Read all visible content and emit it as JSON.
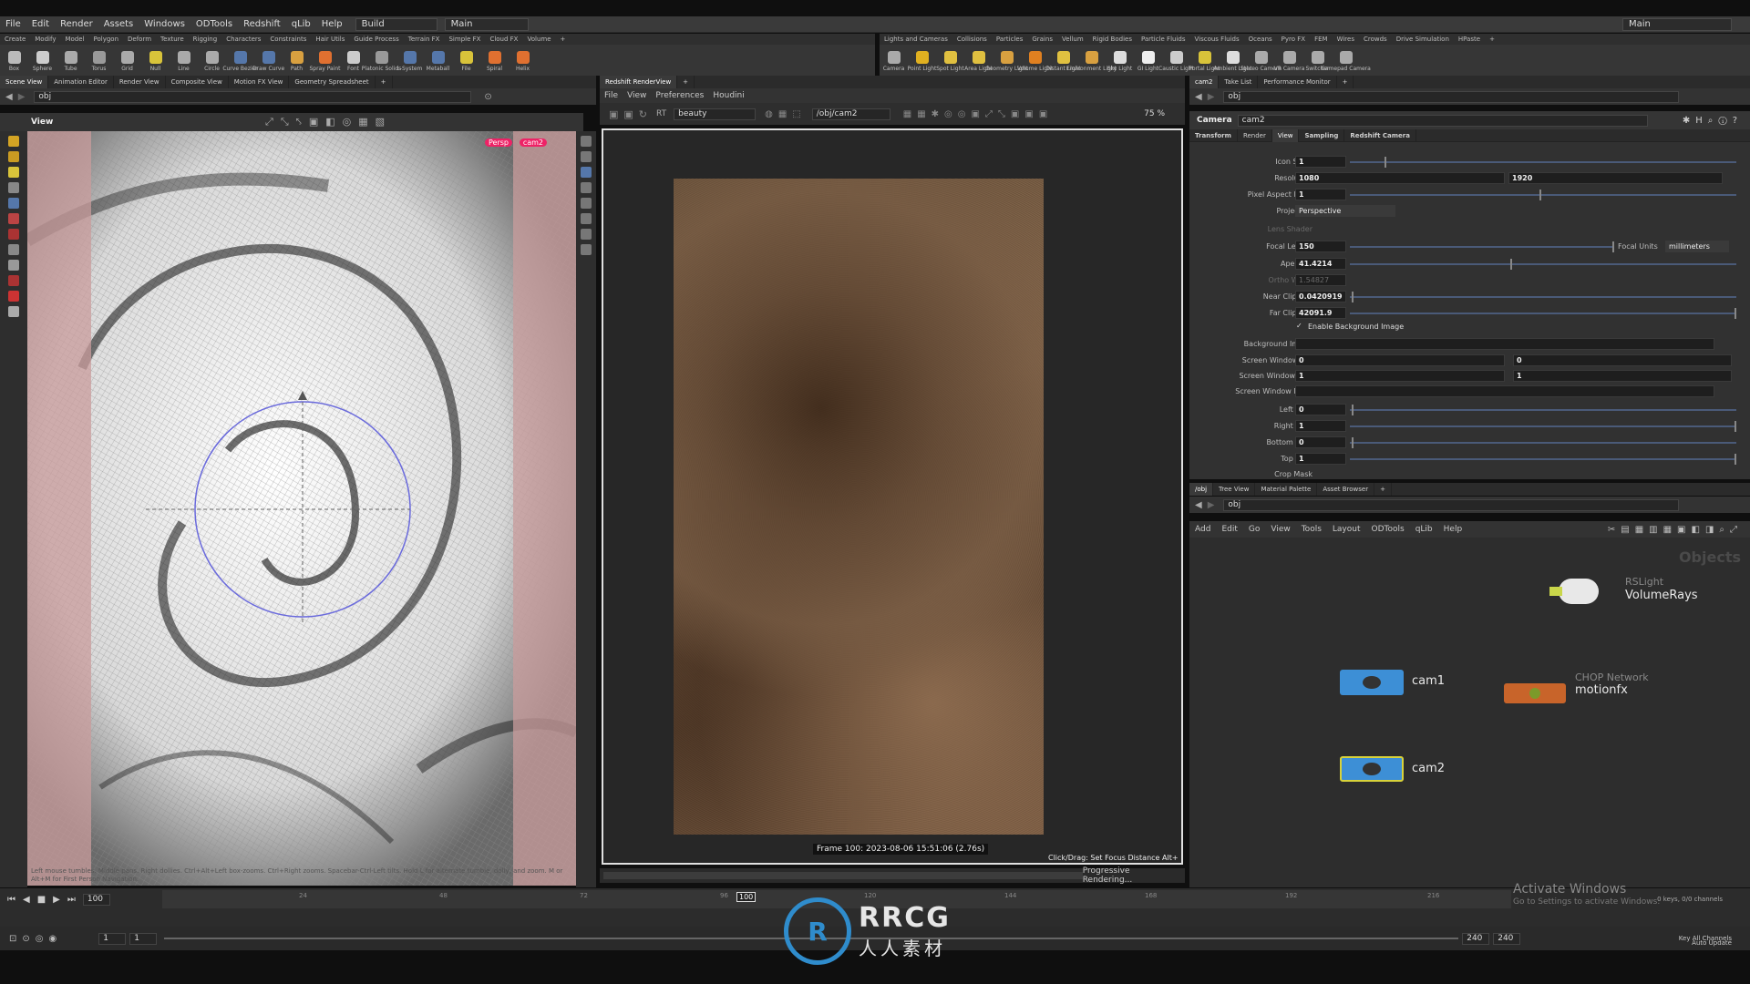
{
  "menu": {
    "items": [
      "File",
      "Edit",
      "Render",
      "Assets",
      "Windows",
      "ODTools",
      "Redshift",
      "qLib",
      "Help"
    ],
    "desktop_label": "Build",
    "context_label": "Main",
    "right_label": "Main"
  },
  "shelf": {
    "tabs_left": [
      "Create",
      "Modify",
      "Model",
      "Polygon",
      "Deform",
      "Texture",
      "Rigging",
      "Characters",
      "Constraints",
      "Hair Utils",
      "Guide Process",
      "Terrain FX",
      "Simple FX",
      "Cloud FX",
      "Volume"
    ],
    "tabs_right": [
      "Lights and Cameras",
      "Collisions",
      "Particles",
      "Grains",
      "Vellum",
      "Rigid Bodies",
      "Particle Fluids",
      "Viscous Fluids",
      "Oceans",
      "Pyro FX",
      "FEM",
      "Wires",
      "Crowds",
      "Drive Simulation",
      "HPaste"
    ],
    "tools_left": [
      "Box",
      "Sphere",
      "Tube",
      "Torus",
      "Grid",
      "Null",
      "Line",
      "Circle",
      "Curve Bezier",
      "Draw Curve",
      "Path",
      "Spray Paint",
      "Font",
      "Platonic Solids",
      "L-System",
      "Metaball",
      "File",
      "Spiral",
      "Helix"
    ],
    "tools_right": [
      "Camera",
      "Point Light",
      "Spot Light",
      "Area Light",
      "Geometry Light",
      "Volume Light",
      "Distant Light",
      "Environment Light",
      "Sky Light",
      "GI Light",
      "Caustic Light",
      "Portal Light",
      "Ambient Light",
      "Stereo Camera",
      "VR Camera",
      "Switcher",
      "Gamepad Camera"
    ]
  },
  "scene_pane": {
    "tabs": [
      "Scene View",
      "Animation Editor",
      "Render View",
      "Composite View",
      "Motion FX View",
      "Geometry Spreadsheet"
    ],
    "path": "obj",
    "view_label": "View",
    "persp_label": "Persp",
    "cam_label": "cam2",
    "hint": "Left mouse tumbles. Middle pans. Right dollies. Ctrl+Alt+Left box-zooms. Ctrl+Right zooms. Spacebar-Ctrl-Left tilts. Hold L for alternate tumble, dolly, and zoom. M or Alt+M for First Person Navigation."
  },
  "render_pane": {
    "tab": "Redshift RenderView",
    "menu": [
      "File",
      "View",
      "Preferences",
      "Houdini"
    ],
    "aov": "beauty",
    "camera_path": "/obj/cam2",
    "zoom": "75 %",
    "frame_info": "Frame 100: 2023-08-06 15:51:06 (2.76s)",
    "hint": "Click/Drag: Set Focus Distance Alt+",
    "status": "Progressive Rendering..."
  },
  "param_pane": {
    "tabs": [
      "cam2",
      "Take List",
      "Performance Monitor"
    ],
    "path": "obj",
    "node_type": "Camera",
    "node_name": "cam2",
    "sub_tabs": [
      "Transform",
      "Render",
      "View",
      "Sampling",
      "Redshift Camera"
    ],
    "params": {
      "icon_scale": {
        "label": "Icon Scale",
        "value": "1"
      },
      "resolution": {
        "label": "Resolution",
        "value": "1080",
        "value2": "1920"
      },
      "pixel_aspect": {
        "label": "Pixel Aspect Ratio",
        "value": "1"
      },
      "projection": {
        "label": "Projection",
        "value": "Perspective"
      },
      "lens_shader": {
        "label": "Lens Shader"
      },
      "focal_length": {
        "label": "Focal Length",
        "value": "150"
      },
      "focal_units": {
        "label": "Focal Units",
        "value": "millimeters"
      },
      "aperture": {
        "label": "Aperture",
        "value": "41.4214"
      },
      "ortho_width": {
        "label": "Ortho Width",
        "value": "1.54827"
      },
      "near_clipping": {
        "label": "Near Clipping",
        "value": "0.0420919"
      },
      "far_clipping": {
        "label": "Far Clipping",
        "value": "42091.9"
      },
      "enable_bg": {
        "label": "Enable Background Image"
      },
      "bg_image": {
        "label": "Background Image"
      },
      "screen_window_xy": {
        "label": "Screen Window X/Y",
        "value": "0",
        "value2": "0"
      },
      "screen_window_size": {
        "label": "Screen Window Size",
        "value": "1",
        "value2": "1"
      },
      "screen_window_mask": {
        "label": "Screen Window Mask"
      },
      "left_crop": {
        "label": "Left Crop",
        "value": "0"
      },
      "right_crop": {
        "label": "Right Crop",
        "value": "1"
      },
      "bottom_crop": {
        "label": "Bottom Crop",
        "value": "0"
      },
      "top_crop": {
        "label": "Top Crop",
        "value": "1"
      },
      "crop_mask": {
        "label": "Crop Mask"
      }
    }
  },
  "network_pane": {
    "tabs": [
      "/obj",
      "Tree View",
      "Material Palette",
      "Asset Browser"
    ],
    "path": "obj",
    "menu": [
      "Add",
      "Edit",
      "Go",
      "View",
      "Tools",
      "Layout",
      "ODTools",
      "qLib",
      "Help"
    ],
    "context_label": "Objects",
    "nodes": {
      "light": {
        "type": "RSLight",
        "name": "VolumeRays"
      },
      "cam1": {
        "name": "cam1"
      },
      "cam2": {
        "name": "cam2"
      },
      "chop": {
        "type": "CHOP Network",
        "name": "motionfx"
      }
    }
  },
  "timeline": {
    "current_frame": "100",
    "frame_marker": "100",
    "ticks": [
      "24",
      "48",
      "72",
      "96",
      "120",
      "144",
      "168",
      "192",
      "216"
    ],
    "start": "1",
    "start2": "1",
    "end": "240",
    "end2": "240",
    "keys_info": "0 keys, 0/0 channels",
    "key_all": "Key All Channels",
    "auto_update": "Auto Update"
  },
  "watermark": {
    "activate_title": "Activate Windows",
    "activate_sub": "Go to Settings to activate Windows.",
    "brand": "RRCG",
    "brand_sub": "人人素材"
  },
  "colors": {
    "accent_blue": "#5577aa",
    "cam1_node": "#3d8fd6",
    "cam2_node": "#d8d23a",
    "chop_node": "#c8642a",
    "viewport_margin": "#c99c9c"
  }
}
